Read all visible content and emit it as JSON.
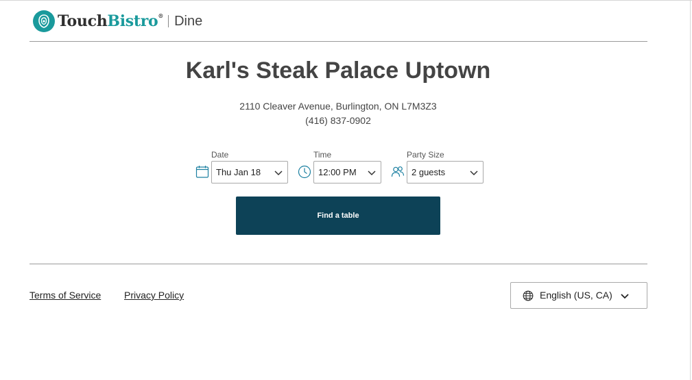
{
  "header": {
    "brand_touch": "Touch",
    "brand_bistro": "Bistro",
    "brand_reg": "®",
    "product": "Dine",
    "logo_icon": "touchbistro-logo-icon",
    "brand_color": "#1a9a9c"
  },
  "restaurant": {
    "name": "Karl's Steak Palace Uptown",
    "address": "2110 Cleaver Avenue, Burlington, ON L7M3Z3",
    "phone": "(416) 837-0902"
  },
  "form": {
    "date": {
      "label": "Date",
      "value": "Thu Jan 18",
      "icon": "calendar-icon"
    },
    "time": {
      "label": "Time",
      "value": "12:00 PM",
      "icon": "clock-icon"
    },
    "party": {
      "label": "Party Size",
      "value": "2 guests",
      "icon": "people-icon"
    },
    "submit_label": "Find a table",
    "button_color": "#0d4257"
  },
  "footer": {
    "terms": "Terms of Service",
    "privacy": "Privacy Policy",
    "language": "English (US, CA)",
    "language_icon": "globe-icon"
  }
}
